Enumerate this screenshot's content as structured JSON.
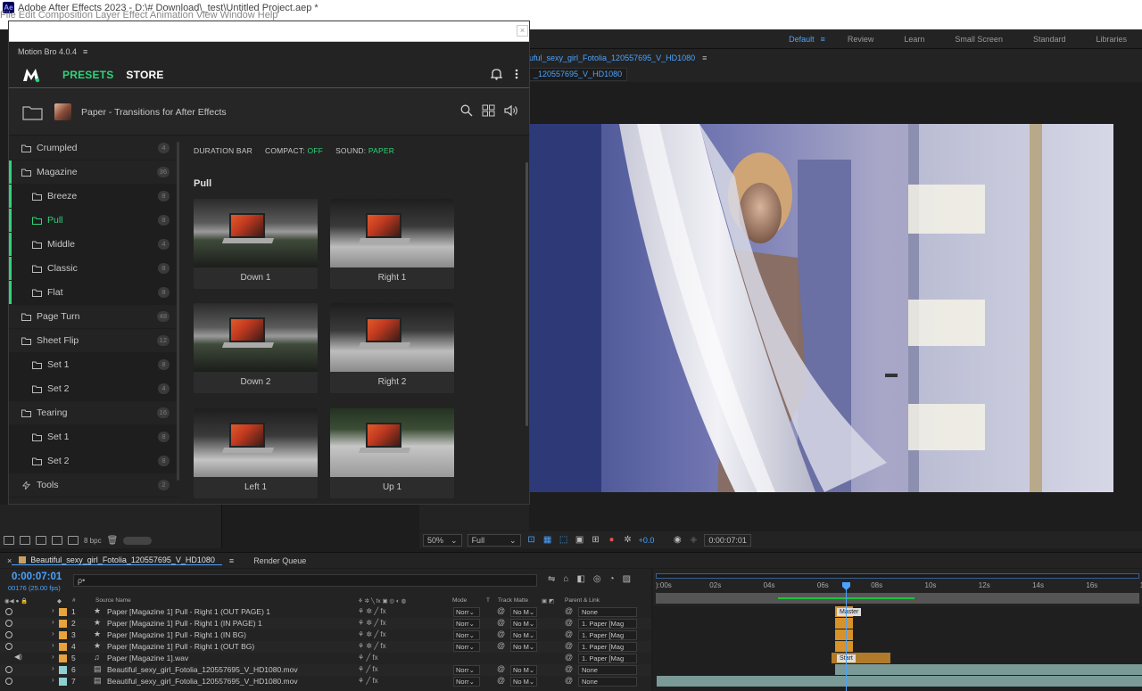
{
  "app": {
    "title": "Adobe After Effects 2023 - D:\\# Download\\_test\\Untitled Project.aep *",
    "menu_fragment": "File  Edit  Composition  Layer  Effect  Animation  View  Window  Help"
  },
  "workspace": {
    "items": [
      "Default",
      "Review",
      "Learn",
      "Small Screen",
      "Standard",
      "Libraries"
    ],
    "active": "Default"
  },
  "composition": {
    "tab_label": "uful_sexy_girl_Fotolia_120557695_V_HD1080",
    "subtab_label": "_120557695_V_HD1080"
  },
  "viewer_footer": {
    "zoom": "50%",
    "resolution": "Full",
    "exposure": "+0.0",
    "timecode": "0:00:07:01"
  },
  "project_footer": {
    "bpc": "8 bpc"
  },
  "motion_bro": {
    "version_title": "Motion Bro 4.0.4",
    "tabs": {
      "presets": "PRESETS",
      "store": "STORE"
    },
    "pack_name": "Paper - Transitions for After Effects",
    "options": {
      "duration": "DURATION BAR",
      "compact_label": "COMPACT:",
      "compact_value": "OFF",
      "sound_label": "SOUND:",
      "sound_value": "PAPER"
    },
    "section_title": "Pull",
    "sidebar": [
      {
        "label": "Crumpled",
        "count": "4",
        "level": "top",
        "icon": "folder-icon"
      },
      {
        "label": "Magazine",
        "count": "36",
        "level": "top",
        "icon": "folder-icon"
      },
      {
        "label": "Breeze",
        "count": "8",
        "level": "sub",
        "icon": "folder-icon"
      },
      {
        "label": "Pull",
        "count": "8",
        "level": "sub",
        "icon": "folder-icon",
        "selected": true
      },
      {
        "label": "Middle",
        "count": "4",
        "level": "sub",
        "icon": "folder-icon"
      },
      {
        "label": "Classic",
        "count": "8",
        "level": "sub",
        "icon": "folder-icon"
      },
      {
        "label": "Flat",
        "count": "8",
        "level": "sub",
        "icon": "folder-icon"
      },
      {
        "label": "Page Turn",
        "count": "48",
        "level": "top",
        "icon": "folder-icon"
      },
      {
        "label": "Sheet Flip",
        "count": "12",
        "level": "top",
        "icon": "folder-icon"
      },
      {
        "label": "Set 1",
        "count": "8",
        "level": "sub",
        "icon": "folder-icon"
      },
      {
        "label": "Set 2",
        "count": "4",
        "level": "sub",
        "icon": "folder-icon"
      },
      {
        "label": "Tearing",
        "count": "16",
        "level": "top",
        "icon": "folder-icon"
      },
      {
        "label": "Set 1",
        "count": "8",
        "level": "sub",
        "icon": "folder-icon"
      },
      {
        "label": "Set 2",
        "count": "8",
        "level": "sub",
        "icon": "folder-icon"
      },
      {
        "label": "Tools",
        "count": "2",
        "level": "top",
        "icon": "lightning-icon"
      }
    ],
    "presets": [
      {
        "label": "Down 1"
      },
      {
        "label": "Right 1"
      },
      {
        "label": "Down 2"
      },
      {
        "label": "Right 2"
      },
      {
        "label": "Left 1"
      },
      {
        "label": "Up 1"
      }
    ]
  },
  "timeline": {
    "tabs": [
      "Beautiful_sexy_girl_Fotolia_120557695_V_HD1080",
      "Render Queue"
    ],
    "time": "0:00:07:01",
    "frames": "00176 (25.00 fps)",
    "search_placeholder": "ρ•",
    "columns": {
      "source_name": "Source Name",
      "mode": "Mode",
      "t": "T",
      "track_matte": "Track Matte",
      "parent": "Parent & Link",
      "hash": "#"
    },
    "ruler": [
      "):00s",
      "02s",
      "04s",
      "06s",
      "08s",
      "10s",
      "12s",
      "14s",
      "16s",
      "18"
    ],
    "markers": {
      "master": "Master",
      "start": "Start"
    },
    "layers": [
      {
        "num": "1",
        "name": "Paper [Magazine 1] Pull - Right 1 (OUT PAGE) 1",
        "mode": "Norr",
        "track": "No M",
        "parent": "None",
        "label_color": "#e8a33b",
        "type": "star"
      },
      {
        "num": "2",
        "name": "Paper [Magazine 1] Pull - Right 1 (IN PAGE) 1",
        "mode": "Norr",
        "track": "No M",
        "parent": "1. Paper [Mag",
        "label_color": "#e8a33b",
        "type": "star"
      },
      {
        "num": "3",
        "name": "Paper [Magazine 1] Pull - Right 1 (IN BG)",
        "mode": "Norr",
        "track": "No M",
        "parent": "1. Paper [Mag",
        "label_color": "#e8a33b",
        "type": "star"
      },
      {
        "num": "4",
        "name": "Paper [Magazine 1] Pull - Right 1 (OUT BG)",
        "mode": "Norr",
        "track": "No M",
        "parent": "1. Paper [Mag",
        "label_color": "#e8a33b",
        "type": "star"
      },
      {
        "num": "5",
        "name": "Paper [Magazine 1].wav",
        "mode": "",
        "track": "",
        "parent": "1. Paper [Mag",
        "label_color": "#e8a33b",
        "type": "audio"
      },
      {
        "num": "6",
        "name": "Beautiful_sexy_girl_Fotolia_120557695_V_HD1080.mov",
        "mode": "Norr",
        "track": "No M",
        "parent": "None",
        "label_color": "#8ecfcf",
        "type": "footage"
      },
      {
        "num": "7",
        "name": "Beautiful_sexy_girl_Fotolia_120557695_V_HD1080.mov",
        "mode": "Norr",
        "track": "No M",
        "parent": "None",
        "label_color": "#8ecfcf",
        "type": "footage"
      }
    ]
  }
}
